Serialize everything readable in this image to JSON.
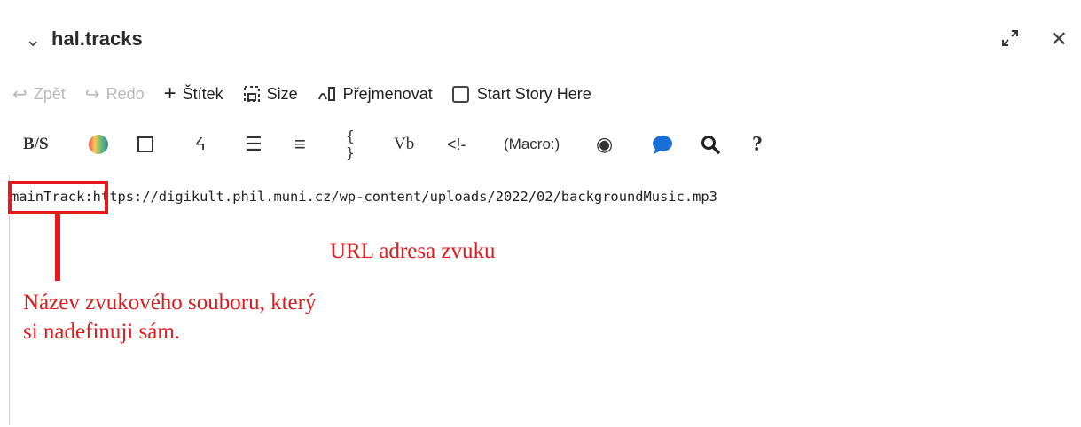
{
  "window": {
    "title": "hal.tracks"
  },
  "toolbar": {
    "undo": "Zpět",
    "redo": "Redo",
    "tag": "Štítek",
    "size": "Size",
    "rename": "Přejmenovat",
    "start_story": "Start Story Here"
  },
  "format_bar": {
    "code_label": "{ }",
    "verbatim_label": "Vb",
    "comment_label": "<!-",
    "macro_label": "(Macro:)",
    "help_label": "?"
  },
  "editor": {
    "name": "mainTrack:",
    "url": "https://digikult.phil.muni.cz/wp-content/uploads/2022/02/backgroundMusic.mp3"
  },
  "annotations": {
    "url_label": "URL adresa zvuku",
    "name_line1": "Název zvukového souboru, který",
    "name_line2": "si nadefinuji sám."
  },
  "colors": {
    "annotation_red": "#e4191e",
    "accent_blue": "#1a6fd4"
  }
}
